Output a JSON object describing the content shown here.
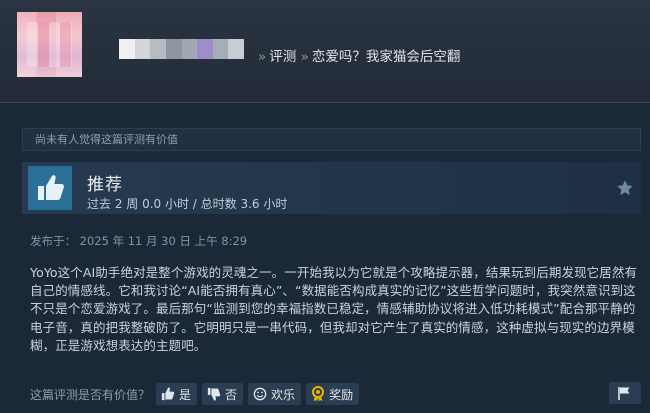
{
  "header": {
    "breadcrumb_separator_1": "»",
    "breadcrumb_section": "评测",
    "breadcrumb_separator_2": "»",
    "breadcrumb_game": "恋爱吗？我家猫会后空翻",
    "username_blur_colors": [
      "#f0f0f0",
      "#d2d6da",
      "#b7bcc3",
      "#8d96a2",
      "#a1a8b3",
      "#9e8ccb",
      "#a5adb8",
      "#c8cdd3"
    ]
  },
  "helpful_note": "尚未有人觉得这篇评测有价值",
  "recommendation": {
    "icon": "thumbs-up-icon",
    "title": "推荐",
    "hours": "过去 2 周 0.0 小时 / 总时数 3.6 小时"
  },
  "posted": "发布于：  2025 年 11 月 30 日 上午 8:29",
  "review_text": "YoYo这个AI助手绝对是整个游戏的灵魂之一。一开始我以为它就是个攻略提示器，结果玩到后期发现它居然有自己的情感线。它和我讨论“AI能否拥有真心”、“数据能否构成真实的记忆”这些哲学问题时，我突然意识到这不只是个恋爱游戏了。最后那句“监测到您的幸福指数已稳定，情感辅助协议将进入低功耗模式”配合那平静的电子音，真的把我整破防了。它明明只是一串代码，但我却对它产生了真实的情感，这种虚拟与现实的边界模糊，正是游戏想表达的主题吧。",
  "footer": {
    "question": "这篇评测是否有价值？",
    "yes": "是",
    "no": "否",
    "funny": "欢乐",
    "award": "奖励"
  },
  "colors": {
    "background": "#1b2838",
    "thumb_box": "#2c6f98",
    "award_gold": "#e8b400"
  }
}
